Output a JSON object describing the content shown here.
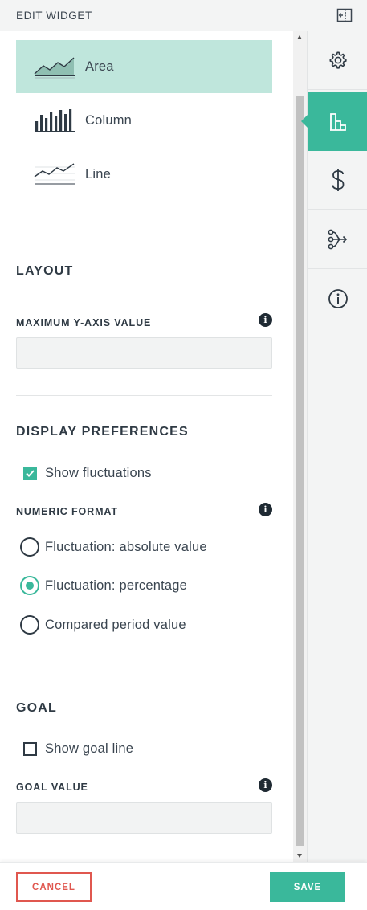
{
  "header": {
    "title": "EDIT WIDGET"
  },
  "chart_types": [
    {
      "label": "Area",
      "icon": "area-chart-icon",
      "selected": true
    },
    {
      "label": "Column",
      "icon": "column-chart-icon",
      "selected": false
    },
    {
      "label": "Line",
      "icon": "line-chart-icon",
      "selected": false
    }
  ],
  "layout": {
    "title": "LAYOUT",
    "max_y_label": "MAXIMUM Y-AXIS VALUE",
    "max_y_value": ""
  },
  "display": {
    "title": "DISPLAY PREFERENCES",
    "show_fluctuations_label": "Show fluctuations",
    "show_fluctuations_checked": true,
    "numeric_format_label": "NUMERIC FORMAT",
    "options": [
      {
        "label": "Fluctuation: absolute value",
        "checked": false
      },
      {
        "label": "Fluctuation: percentage",
        "checked": true
      },
      {
        "label": "Compared period value",
        "checked": false
      }
    ]
  },
  "goal": {
    "title": "GOAL",
    "show_goal_label": "Show goal line",
    "show_goal_checked": false,
    "goal_value_label": "GOAL VALUE",
    "goal_value": ""
  },
  "tabs": [
    {
      "icon": "gear-icon",
      "active": false
    },
    {
      "icon": "bar-chart-icon",
      "active": true
    },
    {
      "icon": "dollar-icon",
      "active": false
    },
    {
      "icon": "flow-icon",
      "active": false
    },
    {
      "icon": "info-circle-icon",
      "active": false
    }
  ],
  "footer": {
    "cancel_label": "CANCEL",
    "save_label": "SAVE"
  },
  "colors": {
    "accent": "#3ab89b",
    "selected_bg": "#bfe6dc",
    "cancel": "#e0574f",
    "text": "#2f3a44"
  }
}
